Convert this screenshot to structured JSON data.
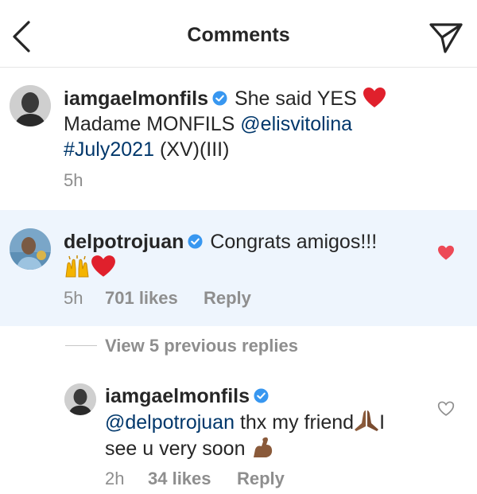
{
  "header": {
    "title": "Comments",
    "back_icon": "chevron-left-icon",
    "send_icon": "paper-plane-icon"
  },
  "caption": {
    "username": "iamgaelmonfils",
    "text_1": "She said YES",
    "text_2": "Madame MONFILS",
    "mention": "@elisvitolina",
    "hashtag": "#July2021",
    "text_3": "(XV)(III)",
    "time": "5h"
  },
  "comment": {
    "username": "delpotrojuan",
    "text": "Congrats amigos!!!",
    "time": "5h",
    "likes": "701 likes",
    "reply_label": "Reply",
    "liked": true,
    "like_color": "#ed4956"
  },
  "view_replies": "View 5 previous replies",
  "reply": {
    "username": "iamgaelmonfils",
    "mention": "@delpotrojuan",
    "text_1": "thx my friend",
    "text_2": "I",
    "text_3": "see u very soon",
    "time": "2h",
    "likes": "34 likes",
    "reply_label": "Reply",
    "liked": false
  },
  "colors": {
    "verified": "#3897f0",
    "link": "#00376b",
    "secondary": "#8e8e8e",
    "highlight_bg": "#eef5fd"
  }
}
